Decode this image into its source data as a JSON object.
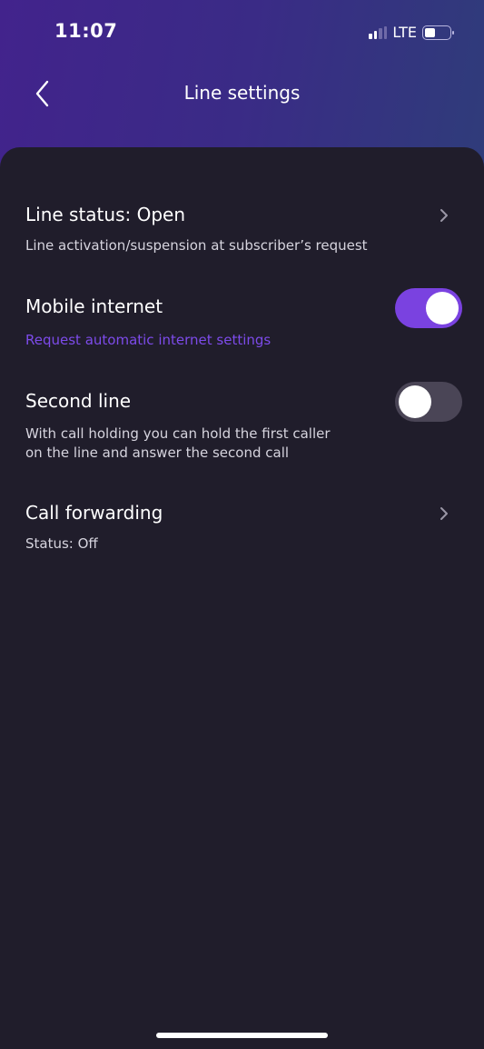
{
  "status_bar": {
    "time": "11:07",
    "network": "LTE",
    "signal_bars": 2,
    "signal_bars_total": 4,
    "battery_level": 0.35
  },
  "header": {
    "title": "Line settings",
    "back_icon": "chevron-left-icon"
  },
  "settings": [
    {
      "title": "Line status: Open",
      "subtitle": "Line activation/suspension at subscriber’s request",
      "control": "chevron"
    },
    {
      "title": "Mobile internet",
      "link": "Request automatic internet settings",
      "control": "toggle",
      "enabled": true
    },
    {
      "title": "Second line",
      "subtitle": "With call holding you can hold the first caller on the line and answer the second call",
      "subtitle_lines": [
        "With call holding you can hold the first caller",
        "on the line and answer the second call"
      ],
      "control": "toggle",
      "enabled": false
    },
    {
      "title": "Call forwarding",
      "subtitle": "Status: Off",
      "control": "chevron"
    }
  ],
  "colors": {
    "accent": "#7a42e0",
    "background": "#201d2b",
    "toggle_off": "#4a4556"
  }
}
